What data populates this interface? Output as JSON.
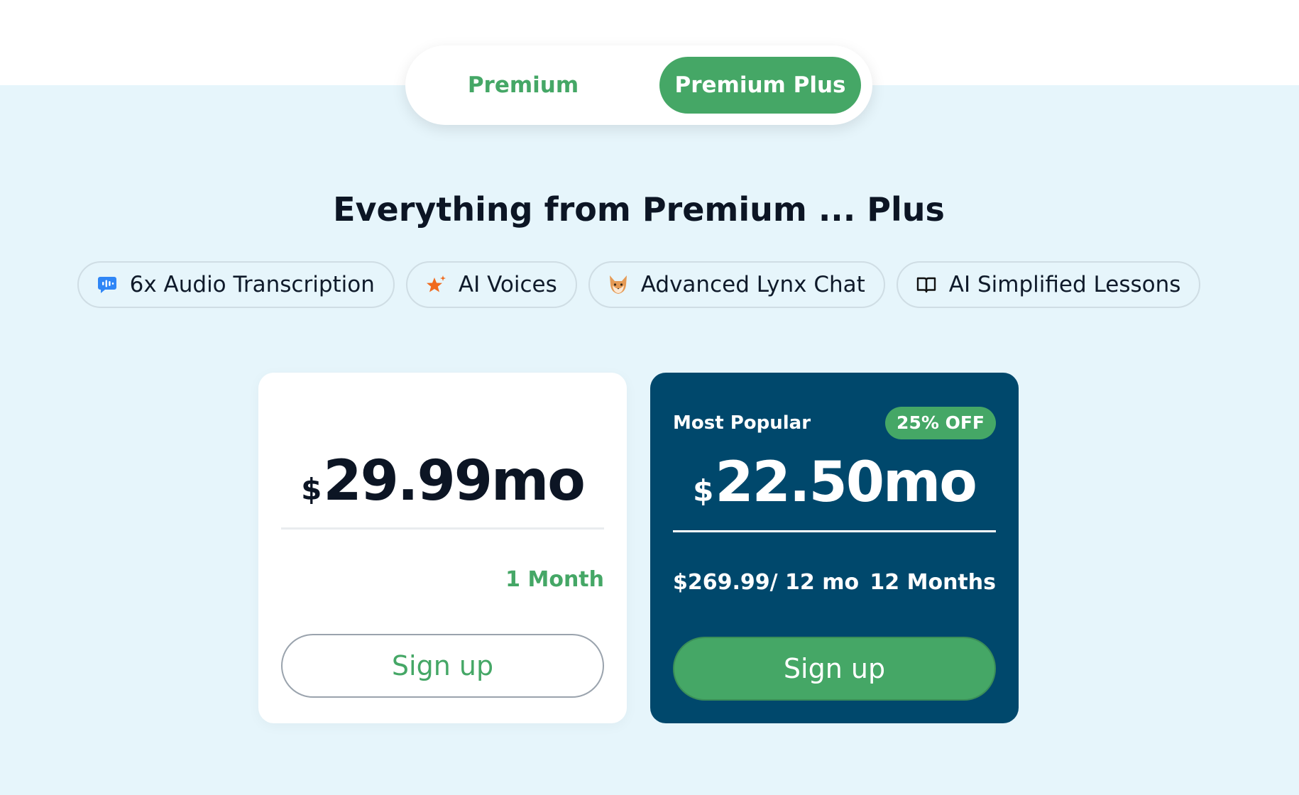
{
  "plan_toggle": {
    "options": [
      {
        "label": "Premium",
        "selected": false
      },
      {
        "label": "Premium Plus",
        "selected": true
      }
    ]
  },
  "headline": "Everything from Premium ... Plus",
  "features": [
    {
      "label": "6x Audio Transcription",
      "icon": "speech-bubble-icon"
    },
    {
      "label": "AI Voices",
      "icon": "sparkle-star-icon"
    },
    {
      "label": "Advanced Lynx Chat",
      "icon": "lynx-face-icon"
    },
    {
      "label": "AI Simplified Lessons",
      "icon": "open-book-icon"
    }
  ],
  "plans": {
    "monthly": {
      "currency": "$",
      "price": "29.99mo",
      "period": "1 Month",
      "signup_label": "Sign up"
    },
    "yearly": {
      "tag": "Most Popular",
      "discount": "25% OFF",
      "currency": "$",
      "price": "22.50mo",
      "total": "$269.99/ 12 mo",
      "period": "12 Months",
      "signup_label": "Sign up"
    }
  },
  "colors": {
    "accent_green": "#45a766",
    "navy_card": "#00486c",
    "background": "#e6f5fb"
  }
}
